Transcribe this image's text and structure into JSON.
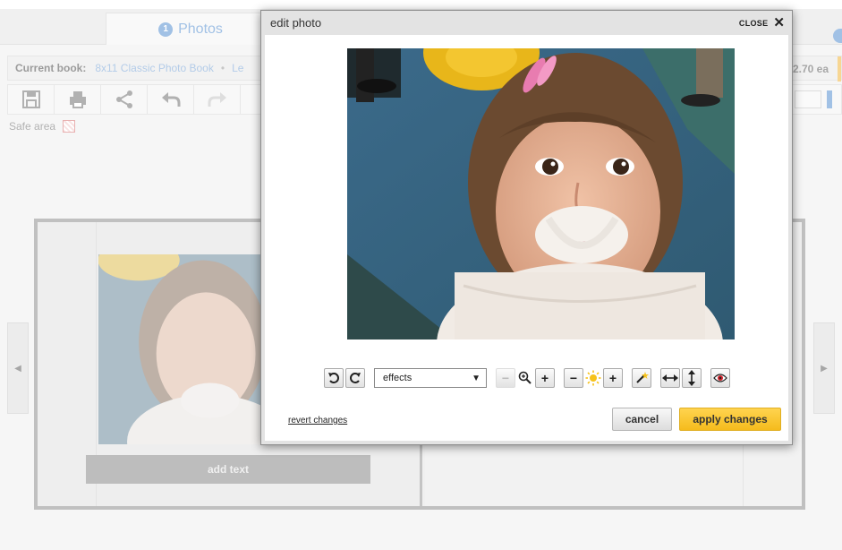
{
  "app": {
    "tabs": [
      {
        "num": "1",
        "label": "Photos"
      }
    ],
    "bookbar": {
      "current_book_label": "Current book:",
      "book_name": "8x11 Classic Photo Book",
      "separator": "•",
      "extra": "Le",
      "price": "2.70 ea"
    },
    "safe_area_label": "Safe area",
    "add_text_label": "add text",
    "arrow_left": "◀",
    "arrow_right": "▶"
  },
  "dialog": {
    "title": "edit photo",
    "close_label": "CLOSE",
    "close_glyph": "✕",
    "effects_value": "effects",
    "revert_label": "revert changes",
    "cancel_label": "cancel",
    "apply_label": "apply changes"
  },
  "icons": {
    "rotate_left": "rotate-left-icon",
    "rotate_right": "rotate-right-icon",
    "zoom": "magnifier-icon",
    "brightness": "sun-icon",
    "magic": "magic-wand-icon",
    "flip_h": "flip-horizontal-icon",
    "flip_v": "flip-vertical-icon",
    "redeye": "red-eye-icon"
  },
  "colors": {
    "accent_blue": "#6fa0d8",
    "apply_yellow": "#f5bb1c"
  }
}
